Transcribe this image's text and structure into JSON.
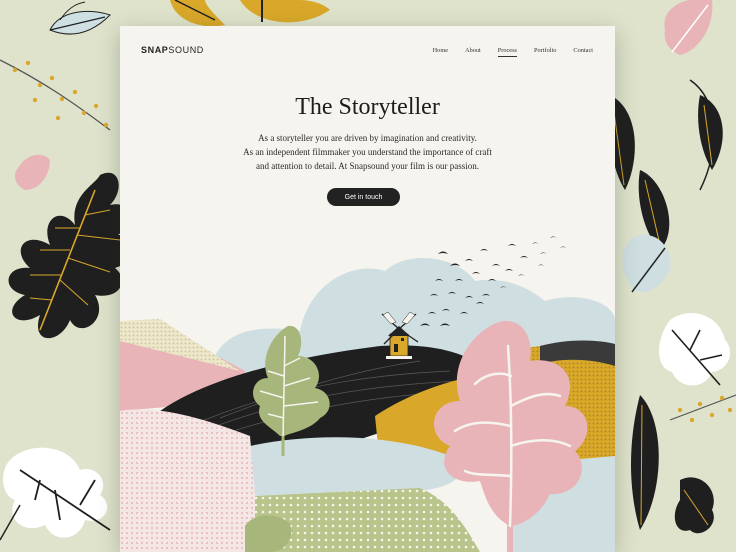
{
  "brand": {
    "logo_bold": "SNAP",
    "logo_rest": "SOUND"
  },
  "nav": {
    "items": [
      {
        "label": "Home"
      },
      {
        "label": "About"
      },
      {
        "label": "Process",
        "active": true
      },
      {
        "label": "Portfolio"
      },
      {
        "label": "Contact"
      }
    ]
  },
  "hero": {
    "title": "The Storyteller",
    "lines": [
      "As a storyteller you are driven by imagination and creativity.",
      "As an independent filmmaker you understand the importance of craft",
      "and attention to detail. At Snapsound your film is our passion."
    ],
    "cta_label": "Get in touch"
  },
  "colors": {
    "background": "#dfe3cc",
    "card": "#f6f4ee",
    "ink": "#222222",
    "mustard": "#d9a82a",
    "pink": "#e9b4b8",
    "sky": "#cfdfe1",
    "sage": "#a7b67a"
  }
}
